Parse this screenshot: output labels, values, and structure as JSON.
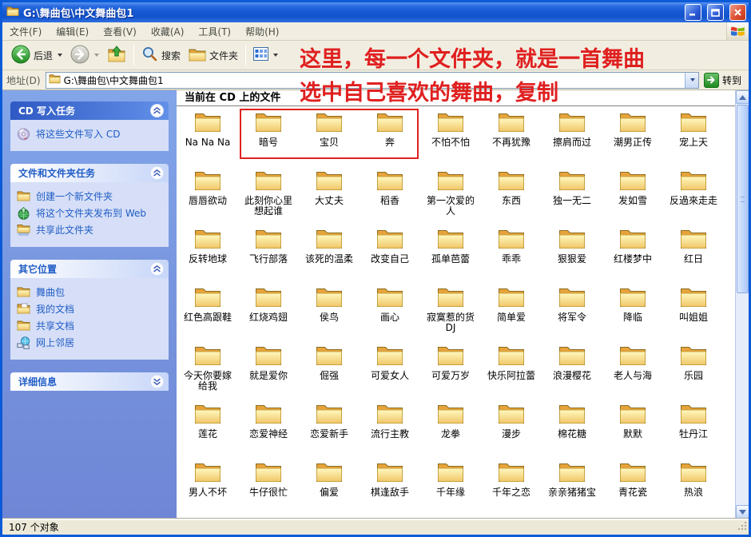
{
  "window": {
    "title": "G:\\舞曲包\\中文舞曲包1"
  },
  "menu_bar": {
    "items": [
      "文件(F)",
      "编辑(E)",
      "查看(V)",
      "收藏(A)",
      "工具(T)",
      "帮助(H)"
    ]
  },
  "toolbar": {
    "back_label": "后退",
    "search_label": "搜索",
    "folders_label": "文件夹"
  },
  "address_bar": {
    "label": "地址(D)",
    "value": "G:\\舞曲包\\中文舞曲包1",
    "go_label": "转到"
  },
  "annotations": {
    "color": "#e02020",
    "line1": "这里，每一个文件夹，就是一首舞曲",
    "line2": "选中自己喜欢的舞曲，复制",
    "boxed_folders": [
      "暗号",
      "宝贝",
      "奔"
    ]
  },
  "sidebar": {
    "sections": [
      {
        "title": "CD 写入任务",
        "style": "special",
        "collapsed": false,
        "items": [
          {
            "icon": "cd-burn",
            "label": "将这些文件写入 CD"
          }
        ]
      },
      {
        "title": "文件和文件夹任务",
        "style": "normal",
        "collapsed": false,
        "items": [
          {
            "icon": "new-folder",
            "label": "创建一个新文件夹"
          },
          {
            "icon": "web-publish",
            "label": "将这个文件夹发布到 Web"
          },
          {
            "icon": "share-folder",
            "label": "共享此文件夹"
          }
        ]
      },
      {
        "title": "其它位置",
        "style": "normal",
        "collapsed": false,
        "items": [
          {
            "icon": "folder",
            "label": "舞曲包"
          },
          {
            "icon": "my-documents",
            "label": "我的文档"
          },
          {
            "icon": "shared-documents",
            "label": "共享文档"
          },
          {
            "icon": "network",
            "label": "网上邻居"
          }
        ]
      },
      {
        "title": "详细信息",
        "style": "normal",
        "collapsed": true,
        "items": []
      }
    ]
  },
  "content": {
    "group_header": "当前在 CD 上的文件",
    "folders": [
      "Na Na Na",
      "暗号",
      "宝贝",
      "奔",
      "不怕不怕",
      "不再犹豫",
      "擦肩而过",
      "潮男正传",
      "宠上天",
      "唇唇欲动",
      "此刻你心里想起谁",
      "大丈夫",
      "稻香",
      "第一次爱的人",
      "东西",
      "独一无二",
      "发如雪",
      "反過來走走",
      "反转地球",
      "飞行部落",
      "该死的温柔",
      "改变自己",
      "孤单芭蕾",
      "乖乖",
      "狠狠爱",
      "红楼梦中",
      "红日",
      "红色高跟鞋",
      "红烧鸡翅",
      "侯鸟",
      "画心",
      "寂寞惹的货DJ",
      "简单爱",
      "将军令",
      "降临",
      "叫姐姐",
      "今天你要嫁给我",
      "就是爱你",
      "倔强",
      "可爱女人",
      "可爱万岁",
      "快乐阿拉蕾",
      "浪漫樱花",
      "老人与海",
      "乐园",
      "莲花",
      "恋爱神经",
      "恋爱新手",
      "流行主教",
      "龙拳",
      "漫步",
      "棉花糖",
      "默默",
      "牡丹江",
      "男人不坏",
      "牛仔很忙",
      "偏爱",
      "棋逢敌手",
      "千年缘",
      "千年之恋",
      "亲亲猪猪宝",
      "青花瓷",
      "热浪"
    ]
  },
  "status_bar": {
    "text": "107 个对象"
  }
}
